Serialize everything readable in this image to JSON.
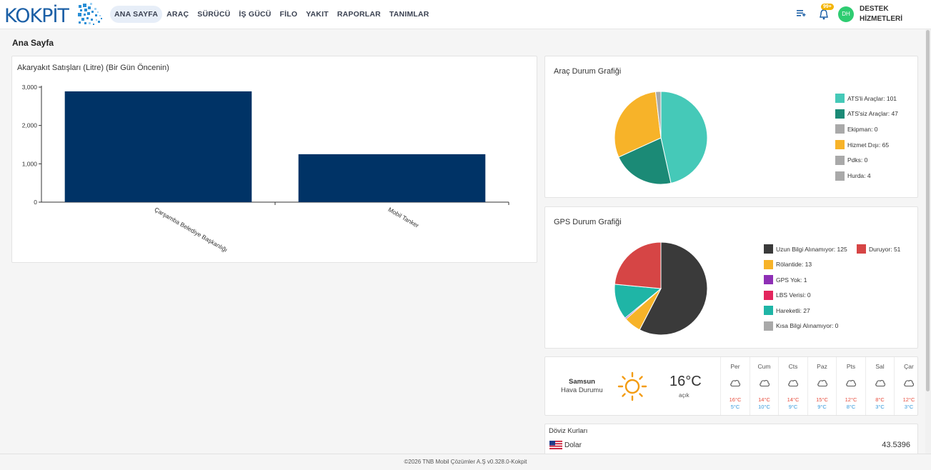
{
  "brand": {
    "name": "KOKPİT"
  },
  "nav": [
    "ANA SAYFA",
    "ARAÇ",
    "SÜRÜCÜ",
    "İŞ GÜCÜ",
    "FİLO",
    "YAKIT",
    "RAPORLAR",
    "TANIMLAR"
  ],
  "header": {
    "notif_badge": "99+",
    "avatar_initials": "DH",
    "user_name_line1": "DESTEK",
    "user_name_line2": "HİZMETLERİ",
    "menu_icon": "list-add-icon",
    "bell_icon": "bell-icon"
  },
  "page_title": "Ana Sayfa",
  "fuel_chart": {
    "title": "Akaryakıt Satışları (Litre) (Bir Gün Öncenin)",
    "chart_data": {
      "type": "bar",
      "categories": [
        "Çarşamba Belediye Başkanlığı",
        "Mobil Tanker"
      ],
      "values": [
        2890,
        1250
      ],
      "ylim": [
        0,
        3000
      ],
      "yticks": [
        "3,000",
        "2,000",
        "1,000",
        "0"
      ],
      "ytick_values": [
        3000,
        2000,
        1000,
        0
      ],
      "color": "#003366"
    }
  },
  "vehicle_chart": {
    "title": "Araç Durum Grafiği",
    "chart_data": {
      "type": "pie",
      "labels": [
        "ATS'li Araçlar",
        "ATS'siz Araçlar",
        "Ekipman",
        "Hizmet Dışı",
        "Pdks",
        "Hurda"
      ],
      "values": [
        101,
        47,
        0,
        65,
        0,
        4
      ],
      "colors": [
        "#45c9b8",
        "#1b8a76",
        "#a9a9a9",
        "#f7b329",
        "#a9a9a9",
        "#a9a9a9"
      ]
    },
    "legend": [
      "ATS'li Araçlar: 101",
      "ATS'siz Araçlar: 47",
      "Ekipman: 0",
      "Hizmet Dışı: 65",
      "Pdks: 0",
      "Hurda: 4"
    ]
  },
  "gps_chart": {
    "title": "GPS Durum Grafiği",
    "chart_data": {
      "type": "pie",
      "labels": [
        "Uzun Bilgi Alınamıyor",
        "Duruyor",
        "Rölantide",
        "GPS Yok",
        "LBS Verisi",
        "Hareketli",
        "Kısa Bilgi Alınamıyor"
      ],
      "values": [
        125,
        51,
        13,
        1,
        0,
        27,
        0
      ],
      "colors": [
        "#3a3a3a",
        "#d64545",
        "#f7b329",
        "#8e2fb5",
        "#e3255d",
        "#1fb5a6",
        "#a9a9a9"
      ]
    },
    "legend": [
      "Uzun Bilgi Alınamıyor: 125",
      "Duruyor: 51",
      "Rölantide: 13",
      "GPS Yok: 1",
      "LBS Verisi: 0",
      "Hareketli: 27",
      "Kısa Bilgi Alınamıyor: 0"
    ]
  },
  "weather": {
    "city": "Samsun",
    "subtitle": "Hava Durumu",
    "temp": "16°C",
    "condition": "açık",
    "icon": "sun-icon",
    "days": [
      {
        "d": "Per",
        "hi": "16°C",
        "lo": "5°C"
      },
      {
        "d": "Cum",
        "hi": "14°C",
        "lo": "10°C"
      },
      {
        "d": "Cts",
        "hi": "14°C",
        "lo": "9°C"
      },
      {
        "d": "Paz",
        "hi": "15°C",
        "lo": "9°C"
      },
      {
        "d": "Pts",
        "hi": "12°C",
        "lo": "8°C"
      },
      {
        "d": "Sal",
        "hi": "8°C",
        "lo": "3°C"
      },
      {
        "d": "Çar",
        "hi": "12°C",
        "lo": "3°C"
      }
    ]
  },
  "currency": {
    "title": "Döviz Kurları",
    "name": "Dolar",
    "value": "43.5396",
    "flag_icon": "us-flag-icon"
  },
  "footer": "©2026 TNB Mobil Çözümler A.Ş v0.328.0-Kokpit",
  "colors": {
    "accent": "#1b5fa6",
    "bar": "#003366",
    "hi": "#e74c3c",
    "lo": "#3498db"
  }
}
